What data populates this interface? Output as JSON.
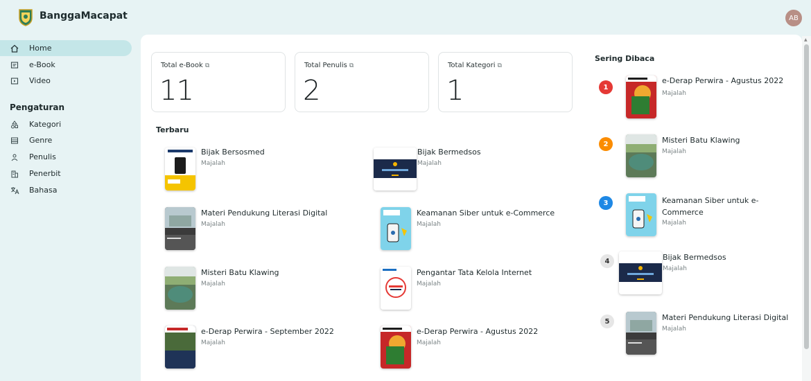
{
  "app": {
    "title": "BanggaMacapat",
    "avatar_initials": "AB"
  },
  "sidebar": {
    "items": [
      {
        "label": "Home",
        "icon": "home-icon"
      },
      {
        "label": "e-Book",
        "icon": "book-icon"
      },
      {
        "label": "Video",
        "icon": "video-icon"
      }
    ],
    "settings_title": "Pengaturan",
    "settings_items": [
      {
        "label": "Kategori",
        "icon": "category-icon"
      },
      {
        "label": "Genre",
        "icon": "genre-icon"
      },
      {
        "label": "Penulis",
        "icon": "person-icon"
      },
      {
        "label": "Penerbit",
        "icon": "building-icon"
      },
      {
        "label": "Bahasa",
        "icon": "translate-icon"
      }
    ]
  },
  "stats": [
    {
      "label": "Total e-Book",
      "value": "11"
    },
    {
      "label": "Total Penulis",
      "value": "2"
    },
    {
      "label": "Total Kategori",
      "value": "1"
    }
  ],
  "latest": {
    "title": "Terbaru",
    "books": [
      {
        "title": "Bijak Bersosmed",
        "type": "Majalah"
      },
      {
        "title": "Bijak Bermedsos",
        "type": "Majalah"
      },
      {
        "title": "Materi Pendukung Literasi Digital",
        "type": "Majalah"
      },
      {
        "title": "Keamanan Siber untuk e-Commerce",
        "type": "Majalah"
      },
      {
        "title": "Misteri Batu Klawing",
        "type": "Majalah"
      },
      {
        "title": "Pengantar Tata Kelola Internet",
        "type": "Majalah"
      },
      {
        "title": "e-Derap Perwira - September 2022",
        "type": "Majalah"
      },
      {
        "title": "e-Derap Perwira - Agustus 2022",
        "type": "Majalah"
      }
    ]
  },
  "popular": {
    "title": "Sering Dibaca",
    "books": [
      {
        "rank": "1",
        "title": "e-Derap Perwira - Agustus 2022",
        "type": "Majalah"
      },
      {
        "rank": "2",
        "title": "Misteri Batu Klawing",
        "type": "Majalah"
      },
      {
        "rank": "3",
        "title": "Keamanan Siber untuk e-Commerce",
        "type": "Majalah"
      },
      {
        "rank": "4",
        "title": "Bijak Bermedsos",
        "type": "Majalah"
      },
      {
        "rank": "5",
        "title": "Materi Pendukung Literasi Digital",
        "type": "Majalah"
      }
    ]
  },
  "colors": {
    "background": "#e7f3f4",
    "active_nav": "#c4e6e8",
    "rank_1": "#e53935",
    "rank_2": "#fb8c00",
    "rank_3": "#1e88e5",
    "rank_other": "#e6e6e6"
  }
}
